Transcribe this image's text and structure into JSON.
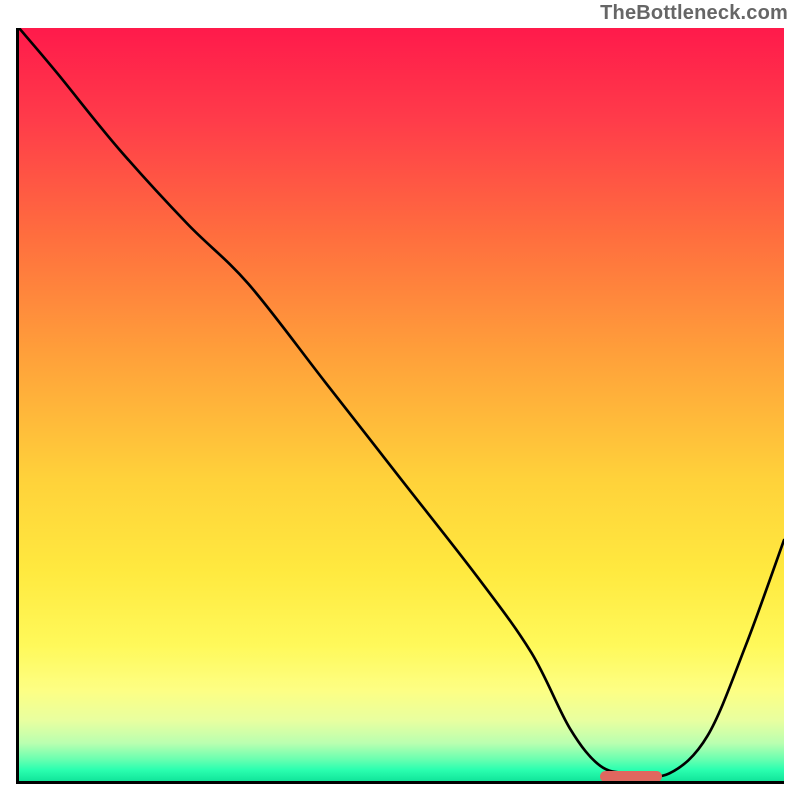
{
  "brand": "TheBottleneck.com",
  "colors": {
    "curve": "#000000",
    "marker": "#e0675f",
    "axis": "#000000"
  },
  "chart_data": {
    "type": "line",
    "title": "",
    "xlabel": "",
    "ylabel": "",
    "xlim": [
      0,
      100
    ],
    "ylim": [
      0,
      100
    ],
    "x": [
      0,
      5,
      13,
      22,
      30,
      40,
      50,
      60,
      67,
      72,
      76,
      80,
      85,
      90,
      95,
      100
    ],
    "values": [
      100,
      94,
      84,
      74,
      66,
      53,
      40,
      27,
      17,
      7,
      2,
      1,
      1,
      6,
      18,
      32
    ],
    "annotations": [
      {
        "type": "marker",
        "x_start": 76,
        "x_end": 84,
        "y": 0.5
      }
    ]
  }
}
